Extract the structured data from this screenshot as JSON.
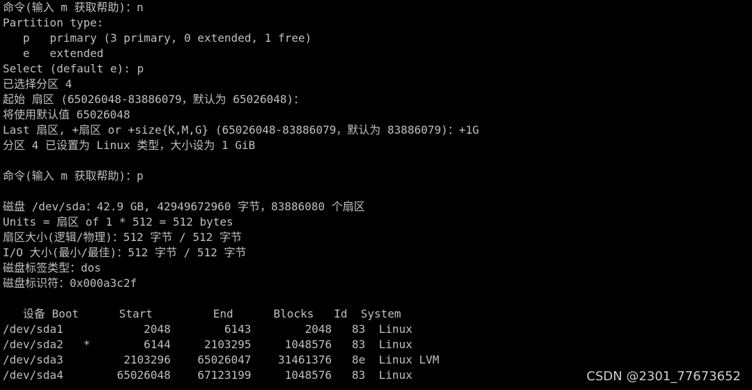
{
  "terminal": {
    "lines": [
      "命令(输入 m 获取帮助)：n",
      "Partition type:",
      "   p   primary (3 primary, 0 extended, 1 free)",
      "   e   extended",
      "Select (default e): p",
      "已选择分区 4",
      "起始 扇区 (65026048-83886079，默认为 65026048)：",
      "将使用默认值 65026048",
      "Last 扇区, +扇区 or +size{K,M,G} (65026048-83886079，默认为 83886079)：+1G",
      "分区 4 已设置为 Linux 类型，大小设为 1 GiB",
      "",
      "命令(输入 m 获取帮助)：p",
      "",
      "磁盘 /dev/sda：42.9 GB, 42949672960 字节，83886080 个扇区",
      "Units = 扇区 of 1 * 512 = 512 bytes",
      "扇区大小(逻辑/物理)：512 字节 / 512 字节",
      "I/O 大小(最小/最佳)：512 字节 / 512 字节",
      "磁盘标签类型：dos",
      "磁盘标识符：0x000a3c2f",
      "",
      "   设备 Boot      Start         End      Blocks   Id  System",
      "/dev/sda1            2048        6143        2048   83  Linux",
      "/dev/sda2   *        6144     2103295     1048576   83  Linux",
      "/dev/sda3         2103296    65026047    31461376   8e  Linux LVM",
      "/dev/sda4        65026048    67123199     1048576   83  Linux"
    ]
  },
  "watermark": "CSDN @2301_77673652",
  "colors": {
    "background": "#000000",
    "text": "#c0c0c0"
  }
}
